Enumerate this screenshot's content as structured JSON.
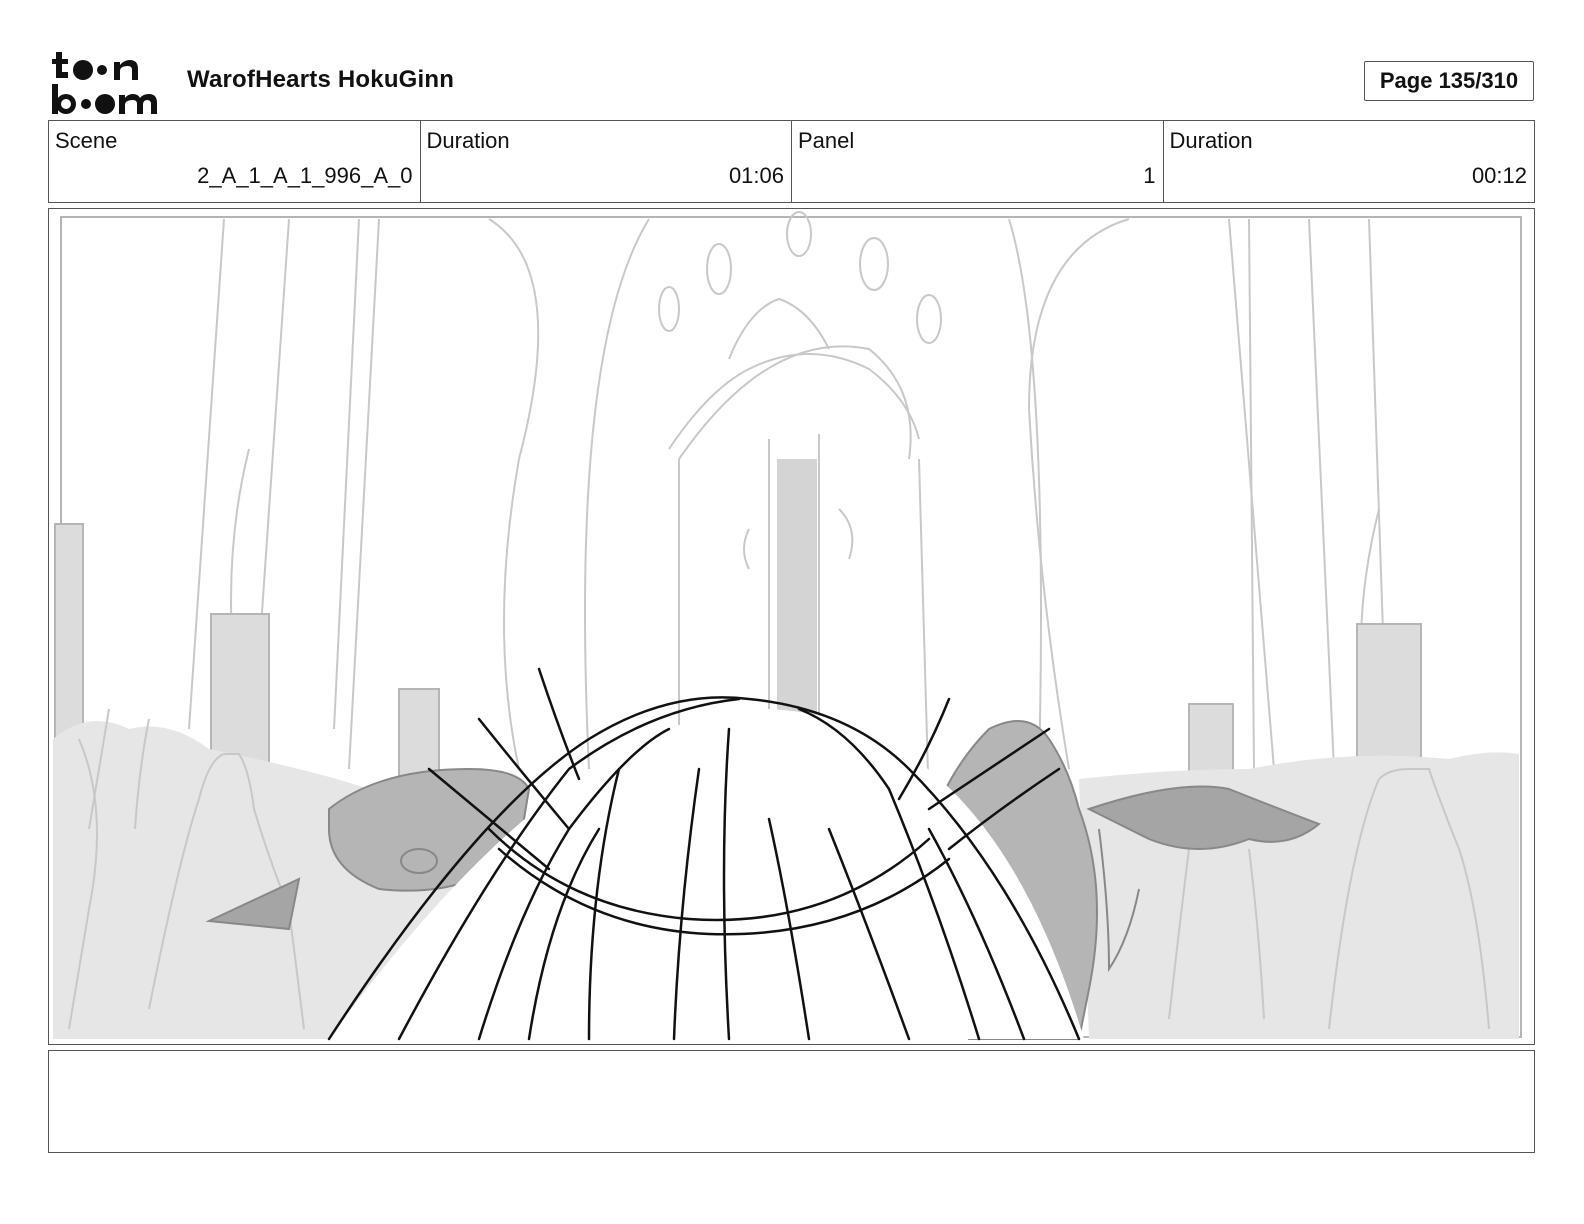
{
  "brand": {
    "logo_text": "toon boom",
    "logo_icon": "toon-boom-logo"
  },
  "header": {
    "project_title": "WarofHearts HokuGinn",
    "page_counter": "Page 135/310"
  },
  "info": {
    "scene_label": "Scene",
    "scene_value": "2_A_1_A_1_996_A_0",
    "scene_duration_label": "Duration",
    "scene_duration_value": "01:06",
    "panel_label": "Panel",
    "panel_value": "1",
    "panel_duration_label": "Duration",
    "panel_duration_value": "00:12"
  },
  "panel": {
    "image_icon": "storyboard-sketch-image"
  },
  "notes": {
    "text": ""
  },
  "colors": {
    "ink": "#111111",
    "border": "#555555",
    "sketch_light": "#c8c8c8",
    "sketch_fill": "#e6e6e6",
    "sketch_mid": "#b5b5b5"
  }
}
